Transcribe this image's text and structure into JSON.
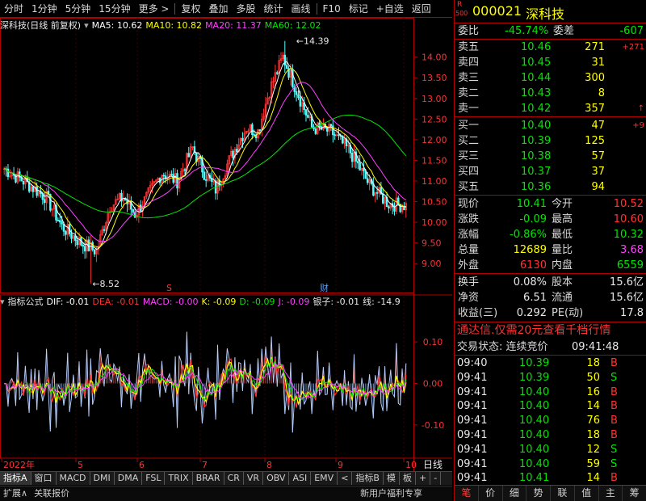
{
  "toolbar": {
    "items": [
      "分时",
      "1分钟",
      "5分钟",
      "15分钟",
      "更多 >",
      "复权",
      "叠加",
      "多股",
      "统计",
      "画线",
      "F10",
      "标记",
      "+自选",
      "返回"
    ]
  },
  "chart": {
    "title": "深科技(日线 前复权)",
    "ma": [
      {
        "label": "MA5: 10.62",
        "color": "#ffffff"
      },
      {
        "label": "MA10: 10.82",
        "color": "#ffff00"
      },
      {
        "label": "MA20: 11.37",
        "color": "#ff40ff"
      },
      {
        "label": "MA60: 12.02",
        "color": "#00e600"
      }
    ],
    "high_mark": "14.39",
    "low_mark": "8.52",
    "markers": {
      "s": "S",
      "cai": "财"
    }
  },
  "indicator": {
    "name": "指标公式",
    "values": [
      {
        "label": "DIF: -0.01",
        "color": "#ffffff"
      },
      {
        "label": "DEA: -0.01",
        "color": "#ff3232"
      },
      {
        "label": "MACD: -0.00",
        "color": "#ff40ff"
      },
      {
        "label": "K: -0.09",
        "color": "#ffff00"
      },
      {
        "label": "D: -0.09",
        "color": "#00e600"
      },
      {
        "label": "J: -0.09",
        "color": "#ff40ff"
      },
      {
        "label": "银子: -0.01",
        "color": "#e8e8e8"
      },
      {
        "label": "线: -14.9",
        "color": "#e8e8e8"
      }
    ]
  },
  "xaxis": {
    "labels": [
      "2022年",
      "5",
      "6",
      "7",
      "8",
      "9",
      "10"
    ],
    "period": "日线"
  },
  "tabs": [
    "指标A",
    "窗口",
    "MACD",
    "DMI",
    "DMA",
    "FSL",
    "TRIX",
    "BRAR",
    "CR",
    "VR",
    "OBV",
    "ASI",
    "EMV",
    "<",
    "指标B",
    "模",
    "板",
    "+",
    "-"
  ],
  "ext": [
    "扩展∧",
    "关联报价",
    "新用户福利专享"
  ],
  "quote": {
    "r_label": "R",
    "r_value": "500",
    "code": "000021",
    "name": "深科技",
    "weibi_label": "委比",
    "weibi": "-45.74%",
    "weicha_label": "委差",
    "weicha": "-607",
    "asks": [
      {
        "label": "卖五",
        "price": "10.46",
        "vol": "271",
        "chg": "+271"
      },
      {
        "label": "卖四",
        "price": "10.45",
        "vol": "31",
        "chg": ""
      },
      {
        "label": "卖三",
        "price": "10.44",
        "vol": "300",
        "chg": ""
      },
      {
        "label": "卖二",
        "price": "10.43",
        "vol": "8",
        "chg": ""
      },
      {
        "label": "卖一",
        "price": "10.42",
        "vol": "357",
        "chg": "↑"
      }
    ],
    "bids": [
      {
        "label": "买一",
        "price": "10.40",
        "vol": "47",
        "chg": "+9"
      },
      {
        "label": "买二",
        "price": "10.39",
        "vol": "125",
        "chg": ""
      },
      {
        "label": "买三",
        "price": "10.38",
        "vol": "57",
        "chg": ""
      },
      {
        "label": "买四",
        "price": "10.37",
        "vol": "37",
        "chg": ""
      },
      {
        "label": "买五",
        "price": "10.36",
        "vol": "94",
        "chg": ""
      }
    ],
    "stats": [
      {
        "l1": "现价",
        "v1": "10.41",
        "c1": "green",
        "l2": "今开",
        "v2": "10.52",
        "c2": "red"
      },
      {
        "l1": "涨跌",
        "v1": "-0.09",
        "c1": "green",
        "l2": "最高",
        "v2": "10.60",
        "c2": "red"
      },
      {
        "l1": "涨幅",
        "v1": "-0.86%",
        "c1": "green",
        "l2": "最低",
        "v2": "10.32",
        "c2": "green"
      },
      {
        "l1": "总量",
        "v1": "12689",
        "c1": "yellow",
        "l2": "量比",
        "v2": "3.68",
        "c2": "magenta"
      },
      {
        "l1": "外盘",
        "v1": "6130",
        "c1": "red",
        "l2": "内盘",
        "v2": "6559",
        "c2": "green"
      }
    ],
    "stats2": [
      {
        "l1": "换手",
        "v1": "0.08%",
        "l2": "股本",
        "v2": "15.6亿"
      },
      {
        "l1": "净资",
        "v1": "6.51",
        "l2": "流通",
        "v2": "15.6亿"
      },
      {
        "l1": "收益(三)",
        "v1": "0.292",
        "l2": "PE(动)",
        "v2": "17.8"
      }
    ],
    "promo": "通达信.仅需20元查看千档行情",
    "trade_status_label": "交易状态: 连续竞价",
    "trade_status_time": "09:41:48",
    "ticks": [
      {
        "time": "09:40",
        "price": "10.39",
        "vol": "18",
        "side": "B"
      },
      {
        "time": "09:41",
        "price": "10.39",
        "vol": "50",
        "side": "S"
      },
      {
        "time": "09:41",
        "price": "10.40",
        "vol": "16",
        "side": "B"
      },
      {
        "time": "09:41",
        "price": "10.40",
        "vol": "14",
        "side": "B"
      },
      {
        "time": "09:41",
        "price": "10.40",
        "vol": "76",
        "side": "B"
      },
      {
        "time": "09:41",
        "price": "10.40",
        "vol": "18",
        "side": "B"
      },
      {
        "time": "09:41",
        "price": "10.40",
        "vol": "12",
        "side": "S"
      },
      {
        "time": "09:41",
        "price": "10.40",
        "vol": "59",
        "side": "S"
      },
      {
        "time": "09:41",
        "price": "10.41",
        "vol": "14",
        "side": "B"
      }
    ],
    "bottom_tabs": [
      "笔",
      "价",
      "细",
      "势",
      "联",
      "值",
      "主",
      "筹"
    ]
  },
  "chart_data": [
    {
      "type": "candlestick",
      "title": "深科技(日线 前复权)",
      "y_ticks": [
        14.0,
        13.5,
        13.0,
        12.5,
        12.0,
        11.5,
        11.0,
        10.5,
        10.0,
        9.5,
        9.0
      ],
      "ylim": [
        8.3,
        14.6
      ],
      "x_labels": [
        "2022年",
        "5",
        "6",
        "7",
        "8",
        "9",
        "10"
      ],
      "high": 14.39,
      "low": 8.52,
      "series": [
        {
          "name": "MA5",
          "last": 10.62
        },
        {
          "name": "MA10",
          "last": 10.82
        },
        {
          "name": "MA20",
          "last": 11.37
        },
        {
          "name": "MA60",
          "last": 12.02
        }
      ]
    },
    {
      "type": "line",
      "y_ticks": [
        0.1,
        0.0,
        -0.1
      ],
      "ylim": [
        -0.18,
        0.18
      ]
    }
  ]
}
